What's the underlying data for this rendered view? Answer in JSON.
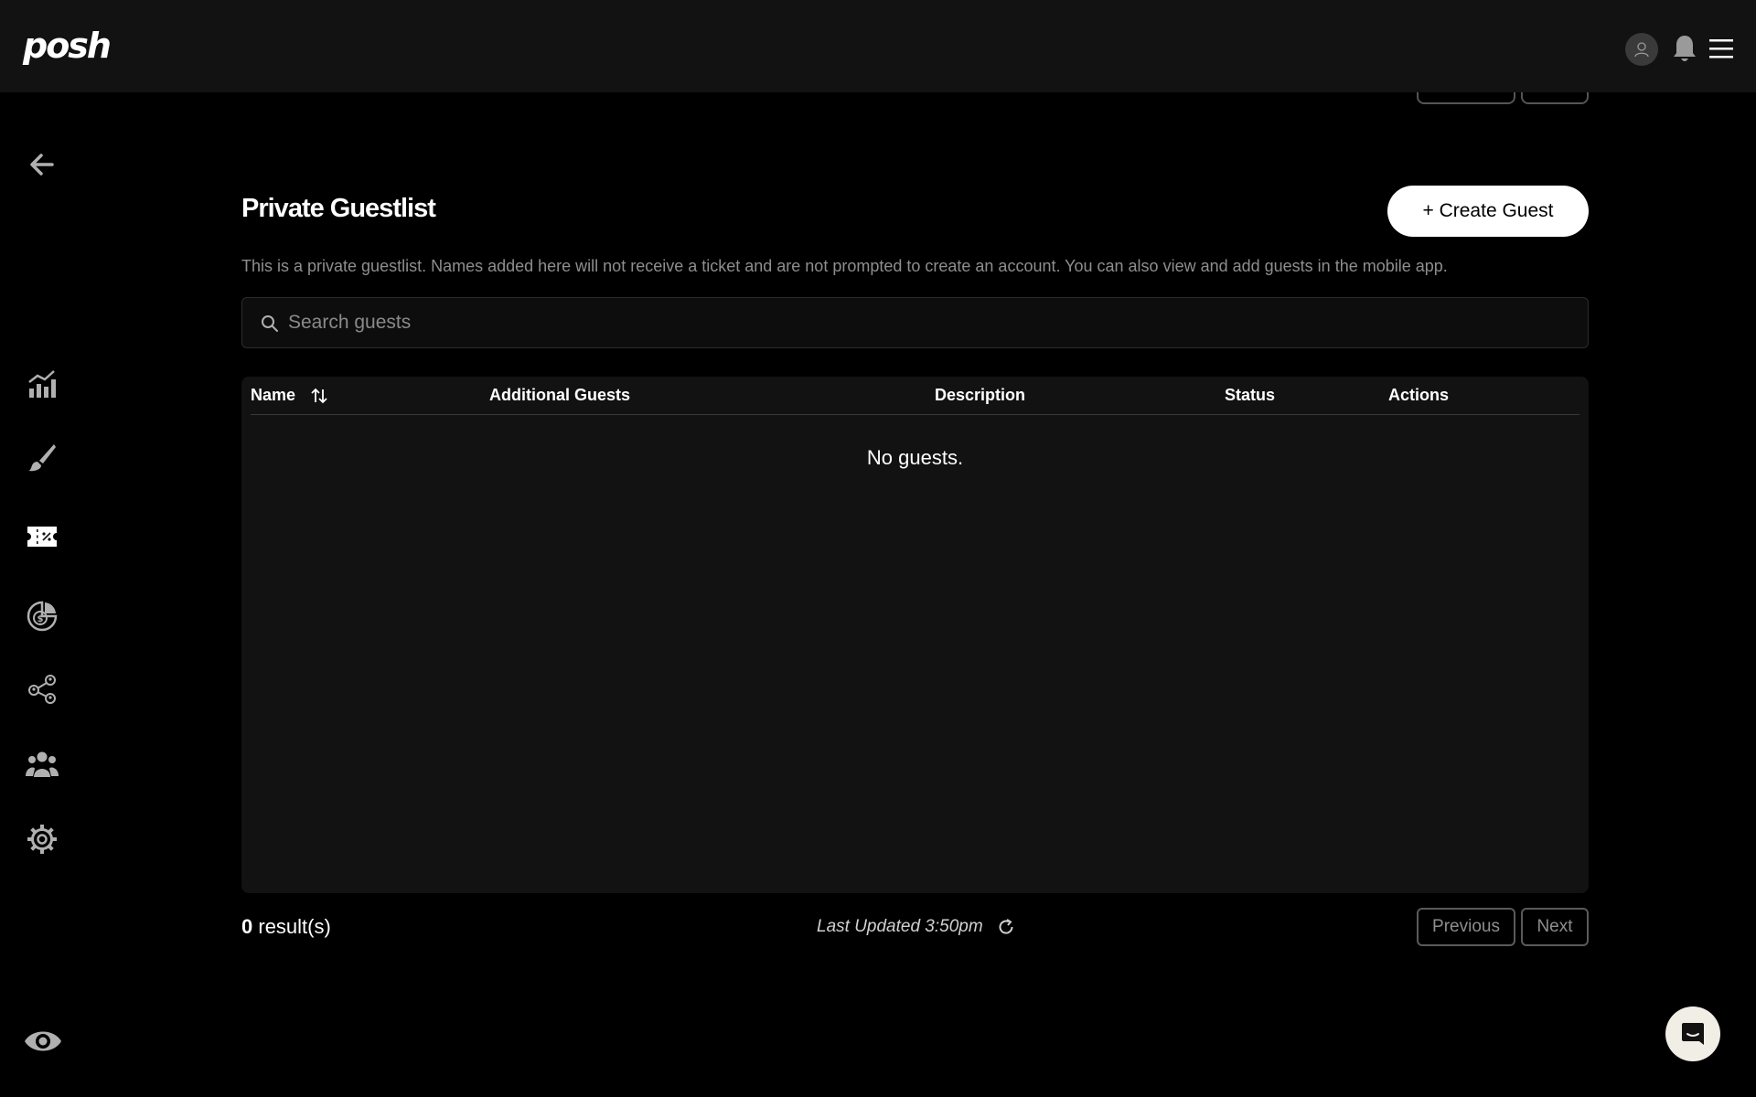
{
  "app": {
    "logo": "posh"
  },
  "header": {
    "avatar_icon": "user-icon",
    "bell_icon": "bell-icon",
    "menu_icon": "hamburger-icon"
  },
  "sidebar": {
    "back_icon": "arrow-left-icon",
    "items": [
      {
        "name": "analytics",
        "icon": "bar-chart-icon"
      },
      {
        "name": "design",
        "icon": "paintbrush-icon"
      },
      {
        "name": "tickets",
        "icon": "ticket-icon"
      },
      {
        "name": "finance",
        "icon": "dollar-pie-icon"
      },
      {
        "name": "network",
        "icon": "people-network-icon"
      },
      {
        "name": "team",
        "icon": "group-icon"
      },
      {
        "name": "settings",
        "icon": "gear-icon"
      }
    ],
    "preview_icon": "eye-icon"
  },
  "main": {
    "title": "Private Guestlist",
    "create_label": "+ Create Guest",
    "description": "This is a private guestlist. Names added here will not receive a ticket and are not prompted to create an account. You can also view and add guests in the mobile app.",
    "search": {
      "placeholder": "Search guests",
      "value": ""
    },
    "table": {
      "columns": [
        "Name",
        "Additional Guests",
        "Description",
        "Status",
        "Actions"
      ],
      "rows": [],
      "empty_text": "No guests."
    },
    "footer": {
      "count": "0",
      "count_suffix": "result(s)",
      "last_updated": "Last Updated 3:50pm",
      "previous_label": "Previous",
      "next_label": "Next"
    }
  },
  "colors": {
    "background": "#000000",
    "header_bg": "#121212",
    "panel_bg": "#121212",
    "muted": "#8e8e8e",
    "accent": "#ffffff"
  }
}
